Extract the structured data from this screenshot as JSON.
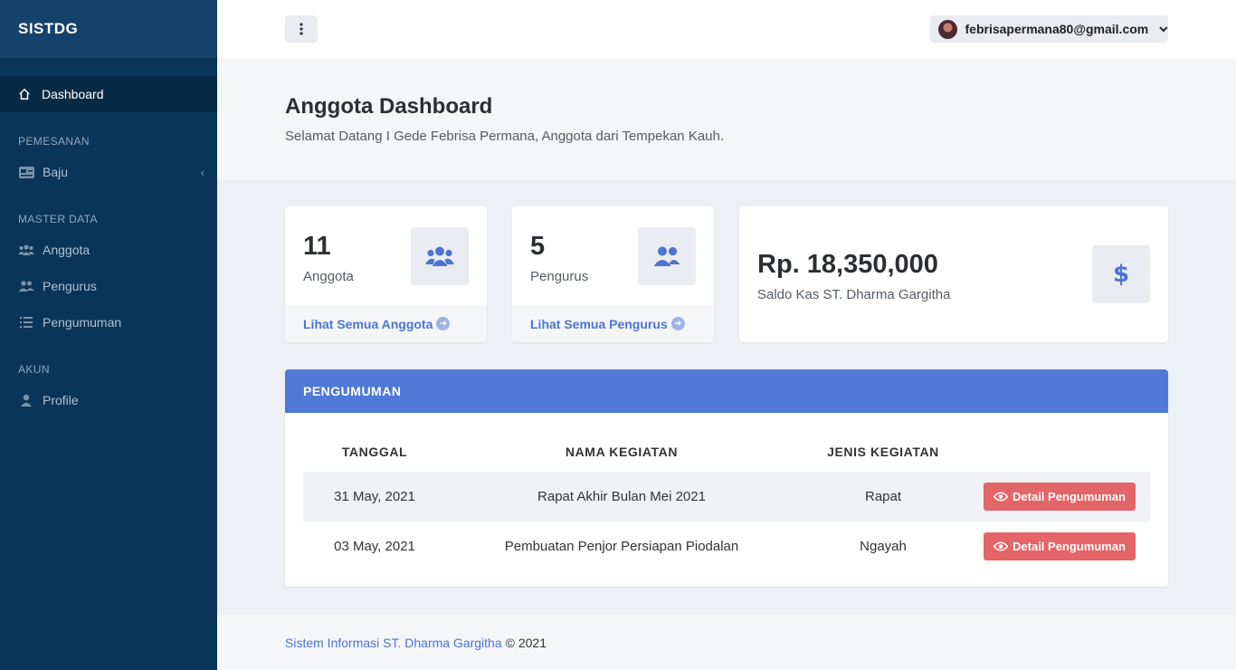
{
  "sidebar": {
    "brand": "SISTDG",
    "active": {
      "label": "Dashboard",
      "icon": "home-icon"
    },
    "sections": [
      {
        "heading": "PEMESANAN",
        "items": [
          {
            "label": "Baju",
            "icon": "card-icon"
          }
        ]
      },
      {
        "heading": "MASTER DATA",
        "items": [
          {
            "label": "Anggota",
            "icon": "users-icon"
          },
          {
            "label": "Pengurus",
            "icon": "user-pair-icon"
          },
          {
            "label": "Pengumuman",
            "icon": "list-icon"
          }
        ]
      },
      {
        "heading": "AKUN",
        "items": [
          {
            "label": "Profile",
            "icon": "user-icon"
          }
        ]
      }
    ]
  },
  "topbar": {
    "user_email": "febrisapermana80@gmail.com"
  },
  "header": {
    "title": "Anggota Dashboard",
    "subtitle": "Selamat Datang I Gede Febrisa Permana, Anggota dari Tempekan Kauh."
  },
  "cards": {
    "anggota": {
      "value": "11",
      "label": "Anggota",
      "link": "Lihat Semua Anggota"
    },
    "pengurus": {
      "value": "5",
      "label": "Pengurus",
      "link": "Lihat Semua Pengurus"
    },
    "saldo": {
      "value": "Rp. 18,350,000",
      "label": "Saldo Kas ST. Dharma Gargitha"
    }
  },
  "pengumuman": {
    "title": "PENGUMUMAN",
    "columns": [
      "TANGGAL",
      "NAMA KEGIATAN",
      "JENIS KEGIATAN"
    ],
    "rows": [
      {
        "tanggal": "31 May, 2021",
        "nama": "Rapat Akhir Bulan Mei 2021",
        "jenis": "Rapat",
        "action": "Detail Pengumuman"
      },
      {
        "tanggal": "03 May, 2021",
        "nama": "Pembuatan Penjor Persiapan Piodalan",
        "jenis": "Ngayah",
        "action": "Detail Pengumuman"
      }
    ]
  },
  "footer": {
    "link": "Sistem Informasi ST. Dharma Gargitha",
    "copyright": "© 2021"
  },
  "colors": {
    "sidebar": "#0b3558",
    "accent": "#5079d7",
    "danger": "#e36567"
  }
}
